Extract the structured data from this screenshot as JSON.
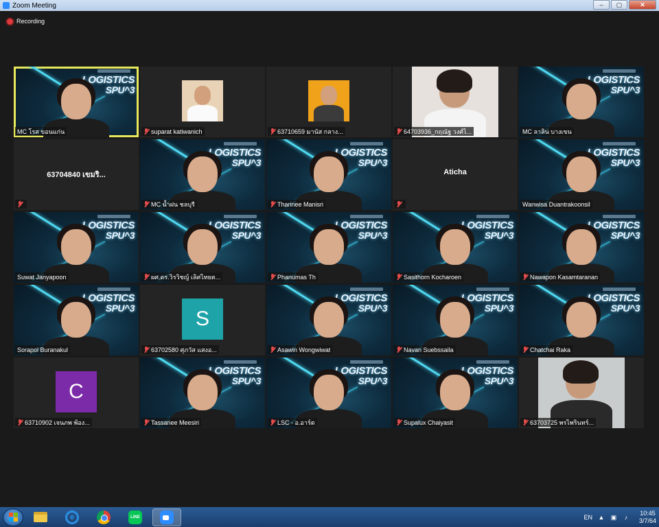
{
  "window": {
    "title": "Zoom Meeting",
    "minimize": "–",
    "maximize": "▢",
    "close": "✕"
  },
  "recording": {
    "label": "Recording"
  },
  "participants": [
    {
      "name": "MC โรส ขอนแก่น",
      "type": "logistics",
      "muted": false,
      "active": true
    },
    {
      "name": "suparat katiwanich",
      "type": "photo",
      "muted": true
    },
    {
      "name": "63710659 มานัส กลาง...",
      "type": "photo",
      "muted": true
    },
    {
      "name": "64703936_กฤณัฐ วงศ์ไ...",
      "type": "camera",
      "muted": true
    },
    {
      "name": "MC ลาลิน บางเขน",
      "type": "logistics",
      "muted": false
    },
    {
      "name": "",
      "center": "63704840 เขมริ...",
      "type": "blank",
      "muted": true
    },
    {
      "name": "MC น้ำฝน ชลบุรี",
      "type": "logistics",
      "muted": true
    },
    {
      "name": "Tharinee Manisri",
      "type": "logistics",
      "muted": true
    },
    {
      "name": "",
      "center": "Aticha",
      "type": "blank",
      "muted": true
    },
    {
      "name": "Wanwisa Duantrakoonsil",
      "type": "logistics",
      "muted": false
    },
    {
      "name": "Suwat Janyapoon",
      "type": "logistics",
      "muted": false
    },
    {
      "name": "ผศ.ดร.วิรวิชญ์ เลิศไทยต...",
      "type": "logistics",
      "muted": true
    },
    {
      "name": "Phanumas Th",
      "type": "logistics",
      "muted": true
    },
    {
      "name": "Sasithorn Kocharoen",
      "type": "logistics",
      "muted": true
    },
    {
      "name": "Nawapon Kasamtaranan",
      "type": "logistics",
      "muted": true
    },
    {
      "name": "Sorapol Buranakul",
      "type": "logistics",
      "muted": false
    },
    {
      "name": "63702580 ศุภวัส แสงอ...",
      "type": "avatar",
      "letter": "S",
      "avatarColor": "#1ea3a8",
      "muted": true
    },
    {
      "name": "Asawin Wongwiwat",
      "type": "logistics",
      "muted": true
    },
    {
      "name": "Navan Suebssaila",
      "type": "logistics",
      "muted": true
    },
    {
      "name": "Chatchai Raka",
      "type": "logistics",
      "muted": true
    },
    {
      "name": "63710902 เจนภพ พ้อง...",
      "type": "avatar",
      "letter": "C",
      "avatarColor": "#7b2aa8",
      "muted": true
    },
    {
      "name": "Tassanee Meesiri",
      "type": "logistics",
      "muted": true
    },
    {
      "name": "LSC - อ.อาร์ต",
      "type": "logistics",
      "muted": true
    },
    {
      "name": "Supalux Chaiyasit",
      "type": "logistics",
      "muted": true
    },
    {
      "name": "63703725 พรไพรินทร์...",
      "type": "camera",
      "muted": true
    }
  ],
  "logo": {
    "line1": "LOGISTICS",
    "line2": "SPU^3"
  },
  "taskbar": {
    "apps": [
      "windows-explorer",
      "internet-explorer",
      "chrome",
      "line",
      "zoom"
    ],
    "line_label": "LINE",
    "ie_label": "e",
    "lang": "EN",
    "time": "10:45",
    "date": "3/7/64"
  }
}
